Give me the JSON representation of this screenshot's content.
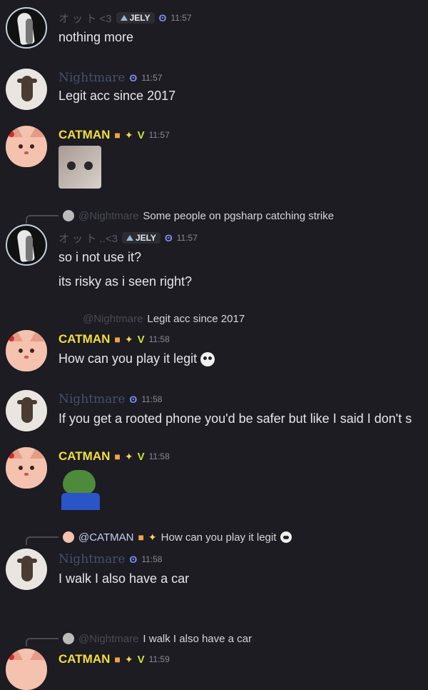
{
  "messages": [
    {
      "author": "オ ッ ト <3",
      "badge": "JELY",
      "time": "11:57",
      "text": "nothing more"
    },
    {
      "author": "Nightmare",
      "time": "11:57",
      "text": "Legit acc since 2017"
    },
    {
      "author": "CATMAN",
      "time": "11:57",
      "attachment": "cat photo"
    },
    {
      "reply_to": "@Nightmare",
      "reply_text": "Some people on pgsharp catching strike",
      "author": "オ ッ ト ..<3",
      "badge": "JELY",
      "time": "11:57",
      "lines": [
        "so i not use it?",
        "its risky as i seen right?"
      ]
    },
    {
      "reply_to": "@Nightmare",
      "reply_text": "Legit acc since 2017",
      "author": "CATMAN",
      "time": "11:58",
      "text": "How can you play it legit"
    },
    {
      "author": "Nightmare",
      "time": "11:58",
      "text": "If you get a rooted phone you'd be safer but like I said I don't s"
    },
    {
      "author": "CATMAN",
      "time": "11:58",
      "attachment": "pepe sticker"
    },
    {
      "reply_to": "@CATMAN",
      "reply_text": "How can you play it legit",
      "author": "Nightmare",
      "time": "11:58",
      "text": "I walk I also have a car"
    },
    {
      "reply_to": "@Nightmare",
      "reply_text": "I walk I also have a car",
      "author": "CATMAN",
      "time": "11:59"
    }
  ],
  "icons": {
    "sparkle": "sparkles-icon",
    "team": "mystic-team-icon",
    "verify": "valor-chevron-icon",
    "skull": "skull-icon"
  }
}
